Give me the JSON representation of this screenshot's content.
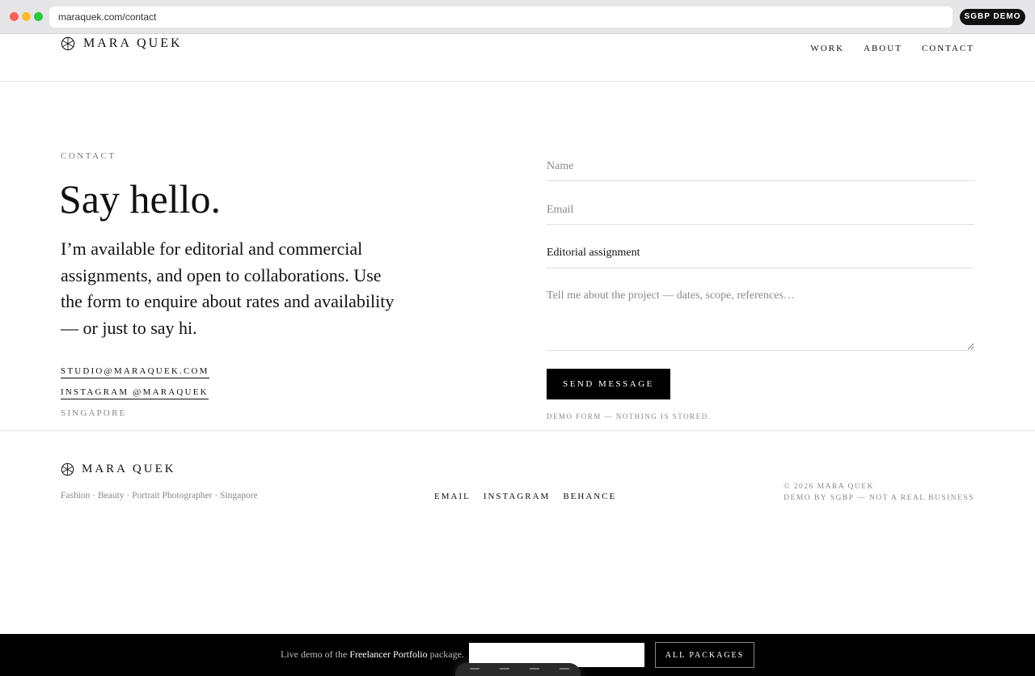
{
  "browser": {
    "url": "maraquek.com/contact",
    "badge": "SGBP DEMO"
  },
  "site": {
    "name": "MARA QUEK",
    "nav": [
      "WORK",
      "ABOUT",
      "CONTACT"
    ]
  },
  "contact": {
    "eyebrow": "CONTACT",
    "headline": "Say hello.",
    "intro": "I’m available for editorial and commercial assignments, and open to collaborations. Use the form to enquire about rates and availability — or just to say hi.",
    "email_link": "STUDIO@MARAQUEK.COM",
    "instagram_link": "INSTAGRAM @MARAQUEK",
    "location": "SINGAPORE"
  },
  "form": {
    "name_placeholder": "Name",
    "email_placeholder": "Email",
    "subject_value": "Editorial assignment",
    "message_placeholder": "Tell me about the project — dates, scope, references…",
    "submit_label": "SEND MESSAGE",
    "note": "DEMO FORM — NOTHING IS STORED."
  },
  "footer": {
    "name": "MARA QUEK",
    "tagline": "Fashion · Beauty · Portrait Photographer · Singapore",
    "links": [
      "EMAIL",
      "INSTAGRAM",
      "BEHANCE"
    ],
    "copyright": "© 2026 MARA QUEK",
    "disclaimer": "DEMO BY SGBP — NOT A REAL BUSINESS"
  },
  "demo_bar": {
    "text_before": "Live demo of the ",
    "package_name": "Freelancer Portfolio",
    "text_after": " package.",
    "button_label": "ALL PACKAGES"
  }
}
